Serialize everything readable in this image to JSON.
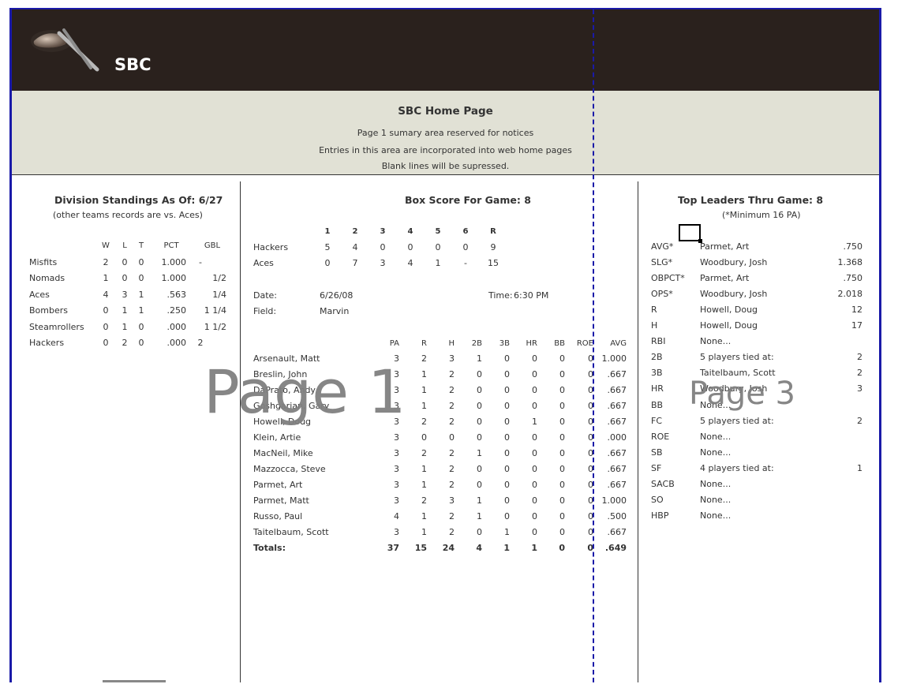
{
  "app": {
    "title": "SBC"
  },
  "notice": {
    "heading": "SBC Home Page",
    "lines": [
      "Page 1 sumary area reserved for notices",
      "Entries in this area are incorporated into web home pages",
      "Blank lines will be supressed."
    ]
  },
  "standings": {
    "title": "Division Standings As Of:  6/27",
    "subtitle": "(other teams records are vs. Aces)",
    "headers": [
      "W",
      "L",
      "T",
      "PCT",
      "GBL"
    ],
    "rows": [
      {
        "team": "Misfits",
        "w": "2",
        "l": "0",
        "t": "0",
        "pct": "1.000",
        "gbl": "-"
      },
      {
        "team": "Nomads",
        "w": "1",
        "l": "0",
        "t": "0",
        "pct": "1.000",
        "gbl": "1/2"
      },
      {
        "team": "Aces",
        "w": "4",
        "l": "3",
        "t": "1",
        "pct": ".563",
        "gbl": "1/4"
      },
      {
        "team": "Bombers",
        "w": "0",
        "l": "1",
        "t": "1",
        "pct": ".250",
        "gbl": "1 1/4"
      },
      {
        "team": "Steamrollers",
        "w": "0",
        "l": "1",
        "t": "0",
        "pct": ".000",
        "gbl": "1 1/2"
      },
      {
        "team": "Hackers",
        "w": "0",
        "l": "2",
        "t": "0",
        "pct": ".000",
        "gbl": "2"
      }
    ]
  },
  "boxscore": {
    "title": "Box Score For Game:  8",
    "innings": [
      "1",
      "2",
      "3",
      "4",
      "5",
      "6",
      "R"
    ],
    "lines": [
      {
        "team": "Hackers",
        "scores": [
          "5",
          "4",
          "0",
          "0",
          "0",
          "0",
          "9"
        ]
      },
      {
        "team": "Aces",
        "scores": [
          "0",
          "7",
          "3",
          "4",
          "1",
          "-",
          "15"
        ]
      }
    ],
    "date_label": "Date:",
    "date": "6/26/08",
    "time_label": "Time:",
    "time": "6:30 PM",
    "field_label": "Field:",
    "field": "Marvin",
    "stat_headers": [
      "PA",
      "R",
      "H",
      "2B",
      "3B",
      "HR",
      "BB",
      "ROE",
      "AVG"
    ],
    "players": [
      {
        "name": "Arsenault, Matt",
        "s": [
          "3",
          "2",
          "3",
          "1",
          "0",
          "0",
          "0",
          "0",
          "1.000"
        ]
      },
      {
        "name": "Breslin, John",
        "s": [
          "3",
          "1",
          "2",
          "0",
          "0",
          "0",
          "0",
          "0",
          ".667"
        ]
      },
      {
        "name": "DaPrato, Andy",
        "s": [
          "3",
          "1",
          "2",
          "0",
          "0",
          "0",
          "0",
          "0",
          ".667"
        ]
      },
      {
        "name": "Goshgarian, Gary",
        "s": [
          "3",
          "1",
          "2",
          "0",
          "0",
          "0",
          "0",
          "0",
          ".667"
        ]
      },
      {
        "name": "Howell, Doug",
        "s": [
          "3",
          "2",
          "2",
          "0",
          "0",
          "1",
          "0",
          "0",
          ".667"
        ]
      },
      {
        "name": "Klein, Artie",
        "s": [
          "3",
          "0",
          "0",
          "0",
          "0",
          "0",
          "0",
          "0",
          ".000"
        ]
      },
      {
        "name": "MacNeil, Mike",
        "s": [
          "3",
          "2",
          "2",
          "1",
          "0",
          "0",
          "0",
          "0",
          ".667"
        ]
      },
      {
        "name": "Mazzocca, Steve",
        "s": [
          "3",
          "1",
          "2",
          "0",
          "0",
          "0",
          "0",
          "0",
          ".667"
        ]
      },
      {
        "name": "Parmet, Art",
        "s": [
          "3",
          "1",
          "2",
          "0",
          "0",
          "0",
          "0",
          "0",
          ".667"
        ]
      },
      {
        "name": "Parmet, Matt",
        "s": [
          "3",
          "2",
          "3",
          "1",
          "0",
          "0",
          "0",
          "0",
          "1.000"
        ]
      },
      {
        "name": "Russo, Paul",
        "s": [
          "4",
          "1",
          "2",
          "1",
          "0",
          "0",
          "0",
          "0",
          ".500"
        ]
      },
      {
        "name": "Taitelbaum, Scott",
        "s": [
          "3",
          "1",
          "2",
          "0",
          "1",
          "0",
          "0",
          "0",
          ".667"
        ]
      }
    ],
    "totals": {
      "name": "Totals:",
      "s": [
        "37",
        "15",
        "24",
        "4",
        "1",
        "1",
        "0",
        "0",
        ".649"
      ]
    }
  },
  "leaders": {
    "title": "Top Leaders Thru Game:  8",
    "subtitle": "(*Minimum 16 PA)",
    "rows": [
      {
        "stat": "AVG*",
        "player": "Parmet, Art",
        "value": ".750"
      },
      {
        "stat": "SLG*",
        "player": "Woodbury, Josh",
        "value": "1.368"
      },
      {
        "stat": "OBPCT*",
        "player": "Parmet, Art",
        "value": ".750"
      },
      {
        "stat": "OPS*",
        "player": "Woodbury, Josh",
        "value": "2.018"
      },
      {
        "stat": "R",
        "player": "Howell, Doug",
        "value": "12"
      },
      {
        "stat": "H",
        "player": "Howell, Doug",
        "value": "17"
      },
      {
        "stat": "RBI",
        "player": "None...",
        "value": ""
      },
      {
        "stat": "2B",
        "player": "5 players tied at:",
        "value": "2"
      },
      {
        "stat": "3B",
        "player": "Taitelbaum, Scott",
        "value": "2"
      },
      {
        "stat": "HR",
        "player": "Woodbury, Josh",
        "value": "3"
      },
      {
        "stat": "BB",
        "player": "None...",
        "value": ""
      },
      {
        "stat": "FC",
        "player": "5 players tied at:",
        "value": "2"
      },
      {
        "stat": "ROE",
        "player": "None...",
        "value": ""
      },
      {
        "stat": "SB",
        "player": "None...",
        "value": ""
      },
      {
        "stat": "SF",
        "player": "4 players tied at:",
        "value": "1"
      },
      {
        "stat": "SACB",
        "player": "None...",
        "value": ""
      },
      {
        "stat": "SO",
        "player": "None...",
        "value": ""
      },
      {
        "stat": "HBP",
        "player": "None...",
        "value": ""
      }
    ]
  },
  "watermarks": {
    "page1": "Page 1",
    "page3": "Page 3"
  },
  "colors": {
    "header_bg": "#2a211d",
    "notice_bg": "#e1e1d5",
    "page_border": "#1a1aa8"
  }
}
